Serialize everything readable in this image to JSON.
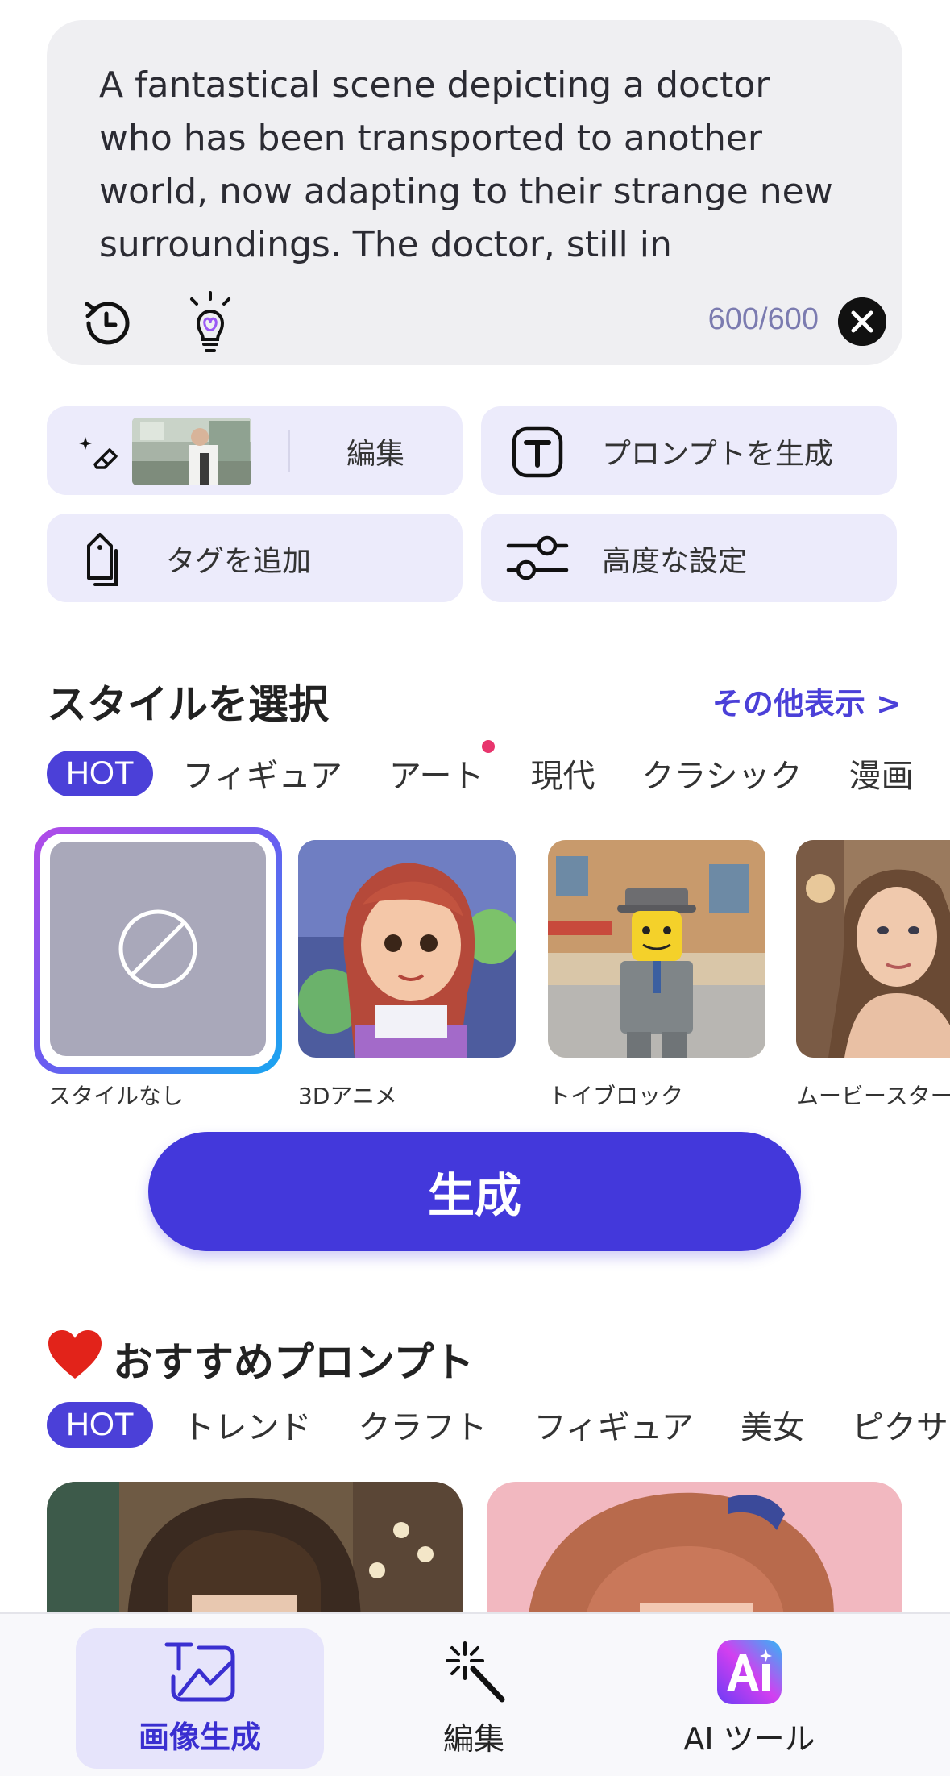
{
  "prompt": {
    "text": "A fantastical scene depicting a doctor who has been transported to another world, now adapting to their strange new surroundings. The doctor, still in",
    "counter": "600/600"
  },
  "actions": {
    "edit": "編集",
    "generate_prompt": "プロンプトを生成",
    "add_tag": "タグを追加",
    "advanced": "高度な設定"
  },
  "styles": {
    "title": "スタイルを選択",
    "more": "その他表示 >",
    "tabs": [
      "HOT",
      "フィギュア",
      "アート",
      "現代",
      "クラシック",
      "漫画"
    ],
    "cards": [
      {
        "label": "スタイルなし"
      },
      {
        "label": "3Dアニメ"
      },
      {
        "label": "トイブロック"
      },
      {
        "label": "ムービースター"
      }
    ]
  },
  "generate_label": "生成",
  "recommend": {
    "title": "おすすめプロンプト",
    "tabs": [
      "HOT",
      "トレンド",
      "クラフト",
      "フィギュア",
      "美女",
      "ピクサー"
    ]
  },
  "nav": {
    "items": [
      {
        "label": "画像生成",
        "active": true
      },
      {
        "label": "編集",
        "active": false
      },
      {
        "label": "AI ツール",
        "active": false
      }
    ]
  },
  "colors": {
    "accent": "#4338db",
    "chip_bg": "#ecebfb",
    "hot_dot": "#e8356d"
  }
}
